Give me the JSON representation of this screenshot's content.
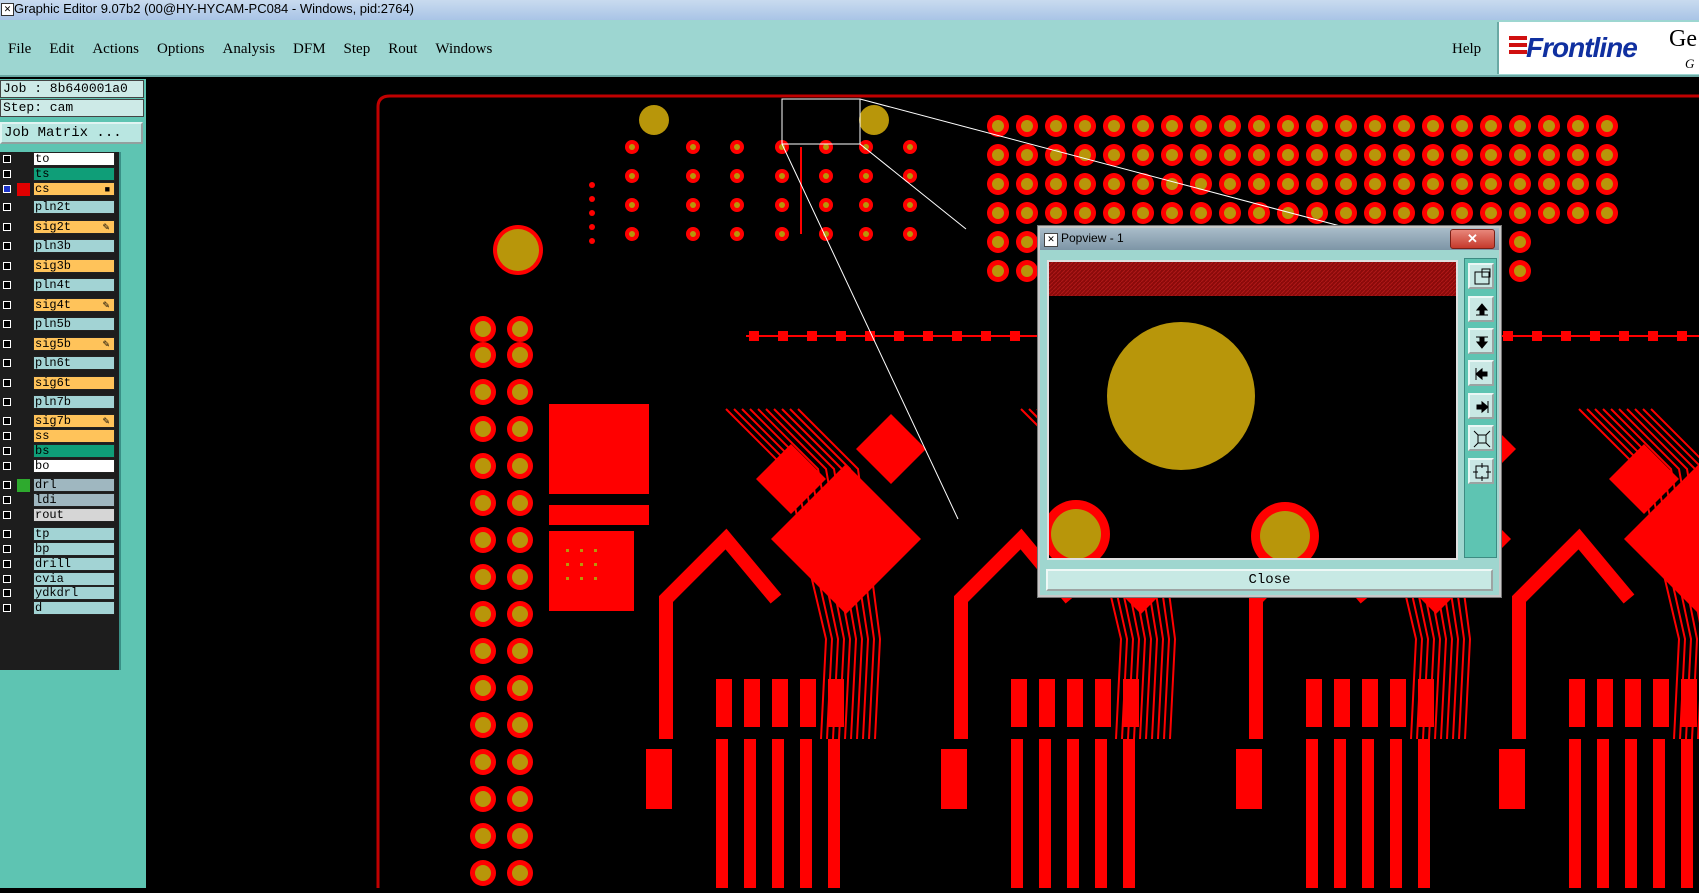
{
  "window": {
    "title": "Graphic Editor 9.07b2 (00@HY-HYCAM-PC084 - Windows, pid:2764)"
  },
  "menu": {
    "items": [
      "File",
      "Edit",
      "Actions",
      "Options",
      "Analysis",
      "DFM",
      "Step",
      "Rout",
      "Windows"
    ],
    "help": "Help"
  },
  "logo": {
    "brand": "Frontline",
    "partial_text": "Ge",
    "partial_sub": "G"
  },
  "job": {
    "job_label": "Job : 8b640001a0",
    "step_label": "Step: cam",
    "matrix_button": "Job Matrix ..."
  },
  "layers": [
    {
      "name": "to",
      "color": "#ffffff",
      "checked": false,
      "swatch": "",
      "mark": ""
    },
    {
      "name": "ts",
      "color": "#0f9e78",
      "checked": false,
      "swatch": "",
      "mark": ""
    },
    {
      "name": "cs",
      "color": "#ffc35a",
      "checked": true,
      "swatch": "#e00000",
      "mark": "■"
    },
    {
      "name": "pln2t",
      "color": "#a2d3d4",
      "checked": false,
      "swatch": "",
      "mark": ""
    },
    {
      "name": "sig2t",
      "color": "#ffc35a",
      "checked": false,
      "swatch": "",
      "mark": "✎"
    },
    {
      "name": "pln3b",
      "color": "#a2d3d4",
      "checked": false,
      "swatch": "",
      "mark": ""
    },
    {
      "name": "sig3b",
      "color": "#ffc35a",
      "checked": false,
      "swatch": "",
      "mark": ""
    },
    {
      "name": "pln4t",
      "color": "#a2d3d4",
      "checked": false,
      "swatch": "",
      "mark": ""
    },
    {
      "name": "sig4t",
      "color": "#ffc35a",
      "checked": false,
      "swatch": "",
      "mark": "✎"
    },
    {
      "name": "pln5b",
      "color": "#a2d3d4",
      "checked": false,
      "swatch": "",
      "mark": ""
    },
    {
      "name": "sig5b",
      "color": "#ffc35a",
      "checked": false,
      "swatch": "",
      "mark": "✎"
    },
    {
      "name": "pln6t",
      "color": "#a2d3d4",
      "checked": false,
      "swatch": "",
      "mark": ""
    },
    {
      "name": "sig6t",
      "color": "#ffc35a",
      "checked": false,
      "swatch": "",
      "mark": ""
    },
    {
      "name": "pln7b",
      "color": "#a2d3d4",
      "checked": false,
      "swatch": "",
      "mark": ""
    },
    {
      "name": "sig7b",
      "color": "#ffc35a",
      "checked": false,
      "swatch": "",
      "mark": "✎"
    },
    {
      "name": "ss",
      "color": "#ffc35a",
      "checked": false,
      "swatch": "",
      "mark": ""
    },
    {
      "name": "bs",
      "color": "#0f9e78",
      "checked": false,
      "swatch": "",
      "mark": ""
    },
    {
      "name": "bo",
      "color": "#ffffff",
      "checked": false,
      "swatch": "",
      "mark": ""
    },
    {
      "name": "drl",
      "color": "#9fb7c0",
      "checked": false,
      "swatch": "#2eaa2e",
      "mark": ""
    },
    {
      "name": "ldi",
      "color": "#9fb7c0",
      "checked": false,
      "swatch": "",
      "mark": ""
    },
    {
      "name": "rout",
      "color": "#d6d6d6",
      "checked": false,
      "swatch": "",
      "mark": ""
    },
    {
      "name": "tp",
      "color": "#a2d3d4",
      "checked": false,
      "swatch": "",
      "mark": ""
    },
    {
      "name": "bp",
      "color": "#a2d3d4",
      "checked": false,
      "swatch": "",
      "mark": ""
    },
    {
      "name": "drill",
      "color": "#a2d3d4",
      "checked": false,
      "swatch": "",
      "mark": ""
    },
    {
      "name": "cvia",
      "color": "#a2d3d4",
      "checked": false,
      "swatch": "",
      "mark": ""
    },
    {
      "name": "ydkdrl",
      "color": "#a2d3d4",
      "checked": false,
      "swatch": "",
      "mark": ""
    },
    {
      "name": "d",
      "color": "#a2d3d4",
      "checked": false,
      "swatch": "",
      "mark": ""
    }
  ],
  "popview": {
    "title": "Popview - 1",
    "close_x": "✕",
    "close_button": "Close",
    "tools": [
      "zoom-fit-icon",
      "pan-up-icon",
      "pan-down-icon",
      "pan-left-icon",
      "pan-right-icon",
      "zoom-out-icon",
      "zoom-in-icon"
    ]
  },
  "colors": {
    "copper": "#ff0000",
    "pad": "#b8960a",
    "board_outline": "#c00000",
    "panel": "#5ec4b2",
    "menubar": "#9dd6d1"
  }
}
